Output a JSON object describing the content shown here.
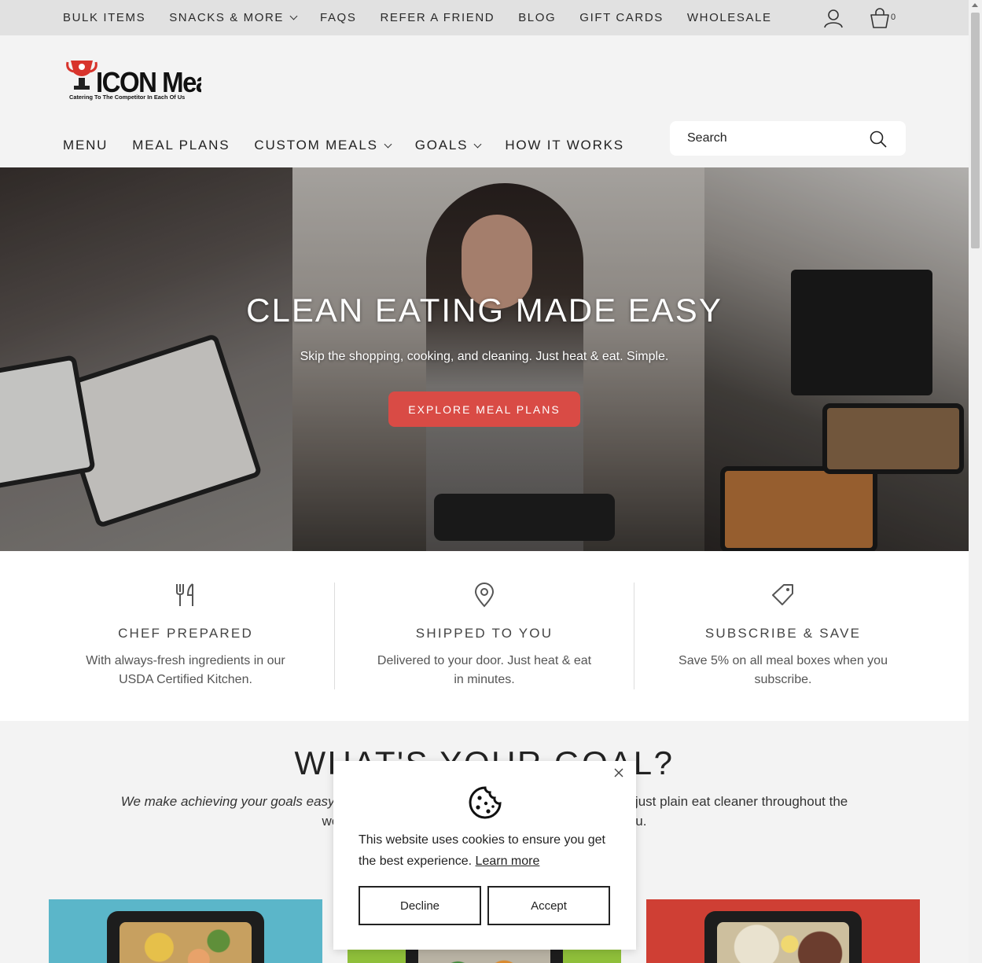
{
  "topbar": {
    "links": [
      "BULK ITEMS",
      "SNACKS & MORE",
      "FAQS",
      "REFER A FRIEND",
      "BLOG",
      "GIFT CARDS",
      "WHOLESALE"
    ],
    "cart_count": "0",
    "icons": [
      "user-icon",
      "cart-icon"
    ]
  },
  "header": {
    "logo_text": "ICON Meals",
    "logo_tagline": "Catering To The Competitor In Each Of Us",
    "nav": [
      "MENU",
      "MEAL PLANS",
      "CUSTOM MEALS",
      "GOALS",
      "HOW IT WORKS"
    ],
    "search_placeholder": "Search"
  },
  "hero": {
    "title": "CLEAN EATING MADE EASY",
    "subtitle": "Skip the shopping, cooking, and cleaning. Just heat & eat. Simple.",
    "cta": "EXPLORE MEAL PLANS"
  },
  "features": [
    {
      "icon": "utensils-icon",
      "title": "CHEF PREPARED",
      "desc": "With always-fresh ingredients in our USDA Certified Kitchen."
    },
    {
      "icon": "location-pin-icon",
      "title": "SHIPPED TO YOU",
      "desc": "Delivered to your door. Just heat & eat in minutes."
    },
    {
      "icon": "tag-icon",
      "title": "SUBSCRIBE & SAVE",
      "desc": "Save 5% on all meal boxes when you subscribe."
    }
  ],
  "goals": {
    "title": "WHAT'S YOUR GOAL?",
    "intro_lead": "We make achieving your goals easy.",
    "intro_rest": " Whether you want to lose weight, build muscle or just plain eat cleaner throughout the week, ICON Meals is the perfect meal provider for you."
  },
  "cookie": {
    "message": "This website uses cookies to ensure you get the best experience.",
    "learn_more": "Learn more",
    "decline": "Decline",
    "accept": "Accept"
  },
  "colors": {
    "accent": "#d94b45",
    "topbar_bg": "#e1e1e1",
    "page_bg": "#f3f3f3",
    "card1_bg": "#5bb6c9",
    "card2_bg": "#8fbf3a",
    "card3_bg": "#cf3f34"
  }
}
